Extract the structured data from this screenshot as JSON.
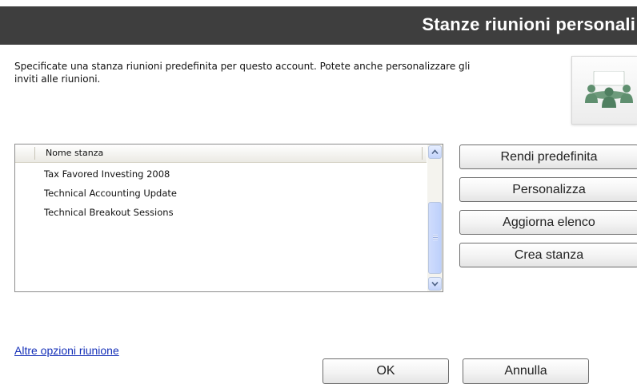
{
  "header": {
    "title": "Stanze riunioni personali"
  },
  "description": "Specificate una stanza riunioni predefinita per questo account.  Potete anche personalizzare gli inviti alle riunioni.",
  "icon": {
    "name": "meeting-room-icon",
    "accent": "#5f8f6f"
  },
  "rooms_list": {
    "column_header": "Nome stanza",
    "rows": [
      "Tax Favored Investing 2008",
      "Technical Accounting Update",
      "Technical Breakout Sessions"
    ]
  },
  "side_buttons": {
    "set_default": "Rendi predefinita",
    "customize": "Personalizza",
    "refresh": "Aggiorna elenco",
    "create": "Crea stanza"
  },
  "footer": {
    "more_options_link": "Altre opzioni riunione",
    "ok": "OK",
    "cancel": "Annulla"
  },
  "colors": {
    "header_bg": "#3e3e3e",
    "link": "#1530b8",
    "scrollbar": "#c3d3fb"
  }
}
